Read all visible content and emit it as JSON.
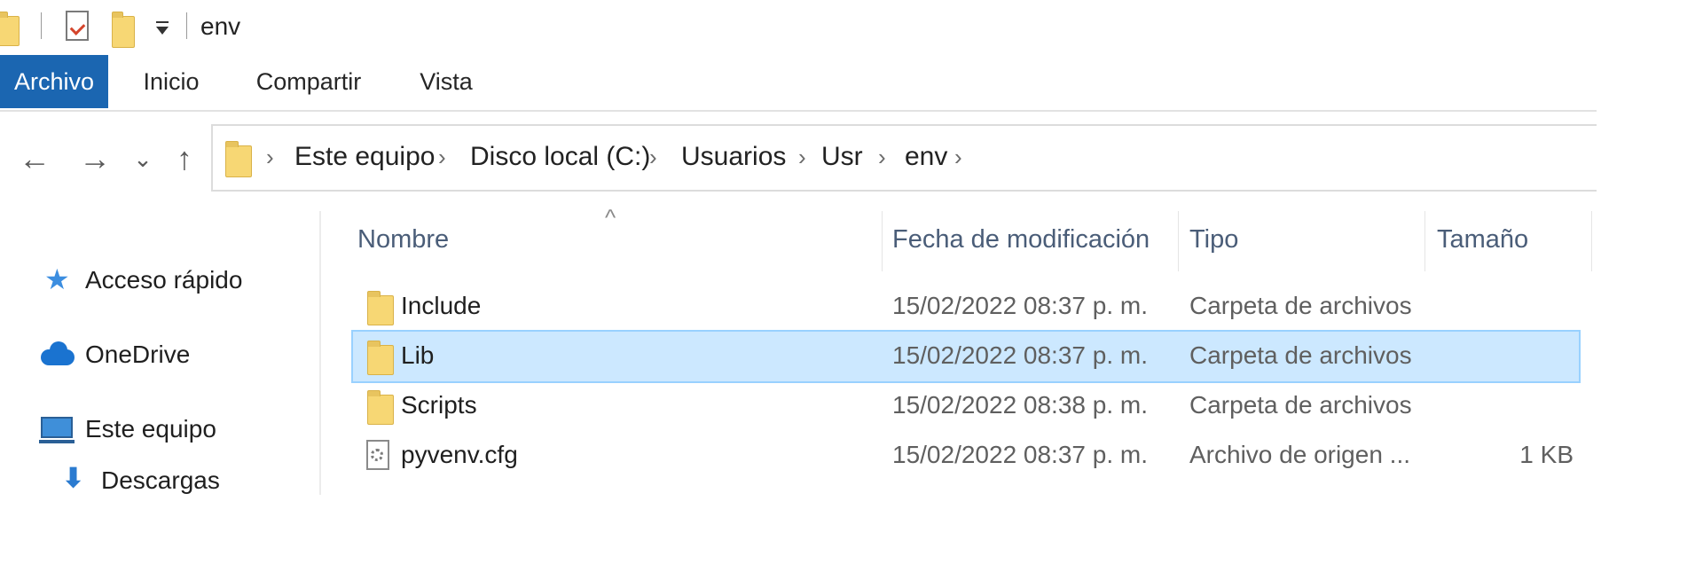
{
  "window": {
    "title": "env"
  },
  "quick_access_toolbar": {
    "icons": [
      "folder-icon",
      "properties-icon",
      "new-folder-icon",
      "customize-dropdown-icon"
    ]
  },
  "ribbon": {
    "tabs": [
      {
        "label": "Archivo",
        "active": true
      },
      {
        "label": "Inicio",
        "active": false
      },
      {
        "label": "Compartir",
        "active": false
      },
      {
        "label": "Vista",
        "active": false
      }
    ]
  },
  "navigation": {
    "back_glyph": "←",
    "forward_glyph": "→",
    "recent_glyph": "⌄",
    "up_glyph": "↑",
    "chevron_glyph": "›",
    "breadcrumbs": [
      "Este equipo",
      "Disco local (C:)",
      "Usuarios",
      "Usr",
      "env"
    ]
  },
  "sidebar": {
    "items": [
      {
        "label": "Acceso rápido",
        "icon": "star-icon"
      },
      {
        "label": "OneDrive",
        "icon": "cloud-icon"
      },
      {
        "label": "Este equipo",
        "icon": "computer-icon"
      },
      {
        "label": "Descargas",
        "icon": "download-arrow-icon"
      }
    ]
  },
  "file_list": {
    "sort_indicator": "^",
    "columns": [
      "Nombre",
      "Fecha de modificación",
      "Tipo",
      "Tamaño"
    ],
    "rows": [
      {
        "name": "Include",
        "date": "15/02/2022 08:37 p. m.",
        "type": "Carpeta de archivos",
        "size": "",
        "icon": "folder-icon",
        "selected": false
      },
      {
        "name": "Lib",
        "date": "15/02/2022 08:37 p. m.",
        "type": "Carpeta de archivos",
        "size": "",
        "icon": "folder-icon",
        "selected": true
      },
      {
        "name": "Scripts",
        "date": "15/02/2022 08:38 p. m.",
        "type": "Carpeta de archivos",
        "size": "",
        "icon": "folder-icon",
        "selected": false
      },
      {
        "name": "pyvenv.cfg",
        "date": "15/02/2022 08:37 p. m.",
        "type": "Archivo de origen ...",
        "size": "1 KB",
        "icon": "settings-file-icon",
        "selected": false
      }
    ]
  },
  "colors": {
    "ribbon_active_tab": "#1b66b1",
    "selection_background": "#cce8ff",
    "selection_border": "#99d1ff",
    "folder_yellow": "#f7d774"
  }
}
